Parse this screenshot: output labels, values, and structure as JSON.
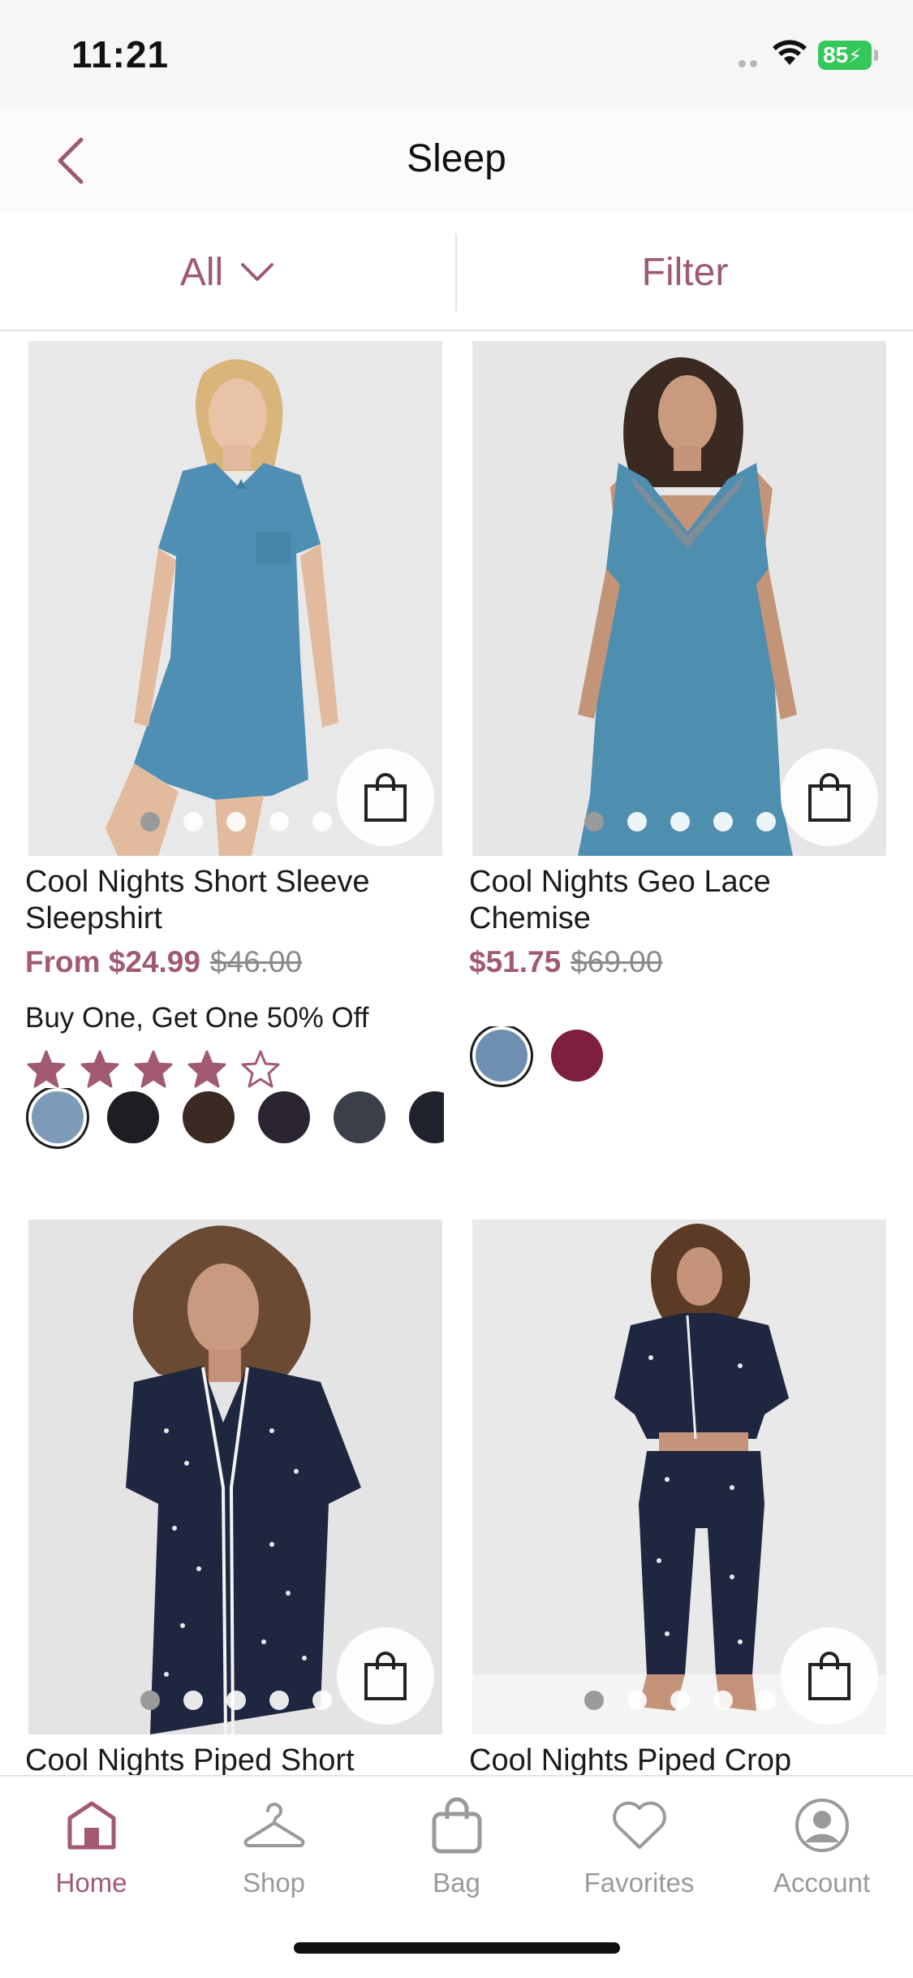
{
  "status_bar": {
    "time": "11:21",
    "battery": "85"
  },
  "header": {
    "title": "Sleep"
  },
  "filter_bar": {
    "all_label": "All",
    "filter_label": "Filter"
  },
  "products": [
    {
      "name": "Cool Nights Short Sleeve Sleepshirt",
      "price": "From $24.99",
      "original_price": "$46.00",
      "promo": "Buy One, Get One 50% Off",
      "rating": 4.5,
      "swatch_colors": [
        "#7d9bb9",
        "#1d1d22",
        "#3b2a24",
        "#2a2530",
        "#3a3f49",
        "#20232b"
      ]
    },
    {
      "name": "Cool Nights Geo Lace Chemise",
      "price": "$51.75",
      "original_price": "$69.00",
      "swatch_colors": [
        "#6f8fb0",
        "#7f1f3e"
      ]
    },
    {
      "name": "Cool Nights Piped Short"
    },
    {
      "name": "Cool Nights Piped Crop"
    }
  ],
  "tabs": [
    {
      "label": "Home",
      "icon": "home-icon",
      "active": true
    },
    {
      "label": "Shop",
      "icon": "hanger-icon"
    },
    {
      "label": "Bag",
      "icon": "bag-icon"
    },
    {
      "label": "Favorites",
      "icon": "heart-icon"
    },
    {
      "label": "Account",
      "icon": "account-icon"
    }
  ],
  "colors": {
    "accent": "#a25a74",
    "muted": "#9a9a9a"
  }
}
